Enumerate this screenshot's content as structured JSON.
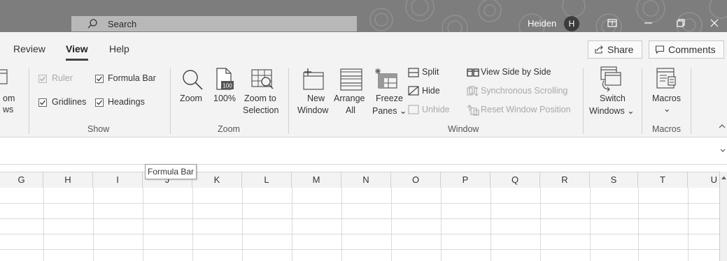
{
  "titlebar": {
    "search_placeholder": "Search",
    "user_name": "Heiden",
    "avatar_initial": "H"
  },
  "tabs": [
    {
      "label": "Review"
    },
    {
      "label": "View"
    },
    {
      "label": "Help"
    }
  ],
  "topbuttons": {
    "share": "Share",
    "comments": "Comments"
  },
  "ribbon": {
    "views_partial": {
      "line1": "om",
      "line2": "ws"
    },
    "show": {
      "label": "Show",
      "ruler": "Ruler",
      "formula_bar": "Formula Bar",
      "gridlines": "Gridlines",
      "headings": "Headings"
    },
    "zoom": {
      "label": "Zoom",
      "zoom": "Zoom",
      "hundred": "100%",
      "zoom_to_line1": "Zoom to",
      "zoom_to_line2": "Selection",
      "icon_100": "100"
    },
    "window": {
      "label": "Window",
      "new_line1": "New",
      "new_line2": "Window",
      "arrange_line1": "Arrange",
      "arrange_line2": "All",
      "freeze_line1": "Freeze",
      "freeze_line2": "Panes ⌄",
      "split": "Split",
      "hide": "Hide",
      "unhide": "Unhide",
      "view_side": "View Side by Side",
      "sync_scroll": "Synchronous Scrolling",
      "reset_pos": "Reset Window Position",
      "switch_line1": "Switch",
      "switch_line2": "Windows ⌄"
    },
    "macros": {
      "label": "Macros",
      "macros": "Macros",
      "chevron": "⌄"
    }
  },
  "tooltip": "Formula Bar",
  "columns": [
    "G",
    "H",
    "I",
    "J",
    "K",
    "L",
    "M",
    "N",
    "O",
    "P",
    "Q",
    "R",
    "S",
    "T",
    "U"
  ]
}
